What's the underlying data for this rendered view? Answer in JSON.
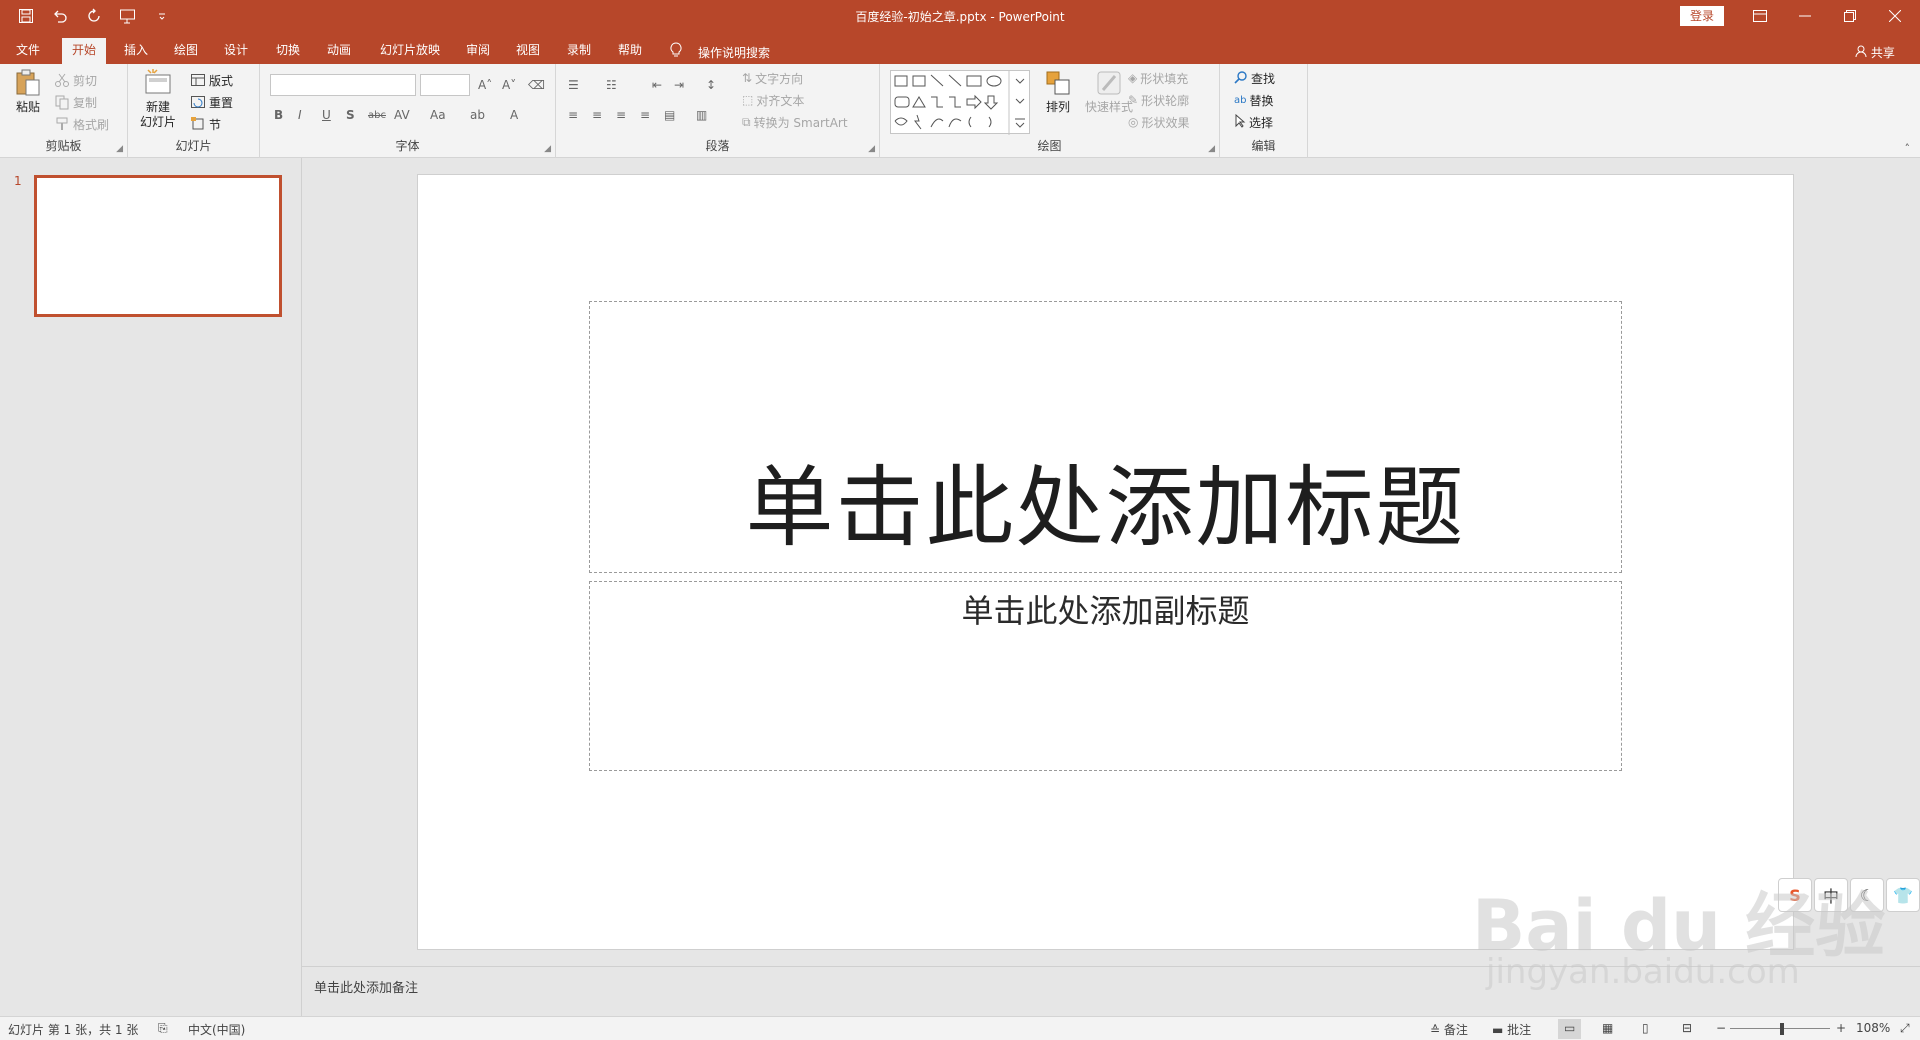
{
  "titlebar": {
    "document_title": "百度经验-初始之章.pptx  -  PowerPoint",
    "login": "登录",
    "qat_icons": [
      "save-icon",
      "undo-icon",
      "redo-icon",
      "presenter-icon",
      "customize-icon"
    ]
  },
  "tabs": [
    "文件",
    "开始",
    "插入",
    "绘图",
    "设计",
    "切换",
    "动画",
    "幻灯片放映",
    "审阅",
    "视图",
    "录制",
    "帮助"
  ],
  "active_tab": "开始",
  "tell_me": "操作说明搜索",
  "share": "共享",
  "ribbon": {
    "clipboard": {
      "label": "剪贴板",
      "paste": "粘贴",
      "cut": "剪切",
      "copy": "复制",
      "format_painter": "格式刷"
    },
    "slides": {
      "label": "幻灯片",
      "new_slide_line1": "新建",
      "new_slide_line2": "幻灯片",
      "layout": "版式",
      "reset": "重置",
      "section": "节"
    },
    "font": {
      "label": "字体",
      "bold": "B",
      "italic": "I",
      "underline": "U",
      "shadow": "S",
      "strike": "abc",
      "spacing": "AV",
      "case": "Aa",
      "color": "A"
    },
    "paragraph": {
      "label": "段落",
      "text_direction": "文字方向",
      "align_text": "对齐文本",
      "smartart": "转换为 SmartArt"
    },
    "drawing": {
      "label": "绘图",
      "arrange": "排列",
      "quick_styles": "快速样式",
      "shape_fill": "形状填充",
      "shape_outline": "形状轮廓",
      "shape_effects": "形状效果"
    },
    "editing": {
      "label": "编辑",
      "find": "查找",
      "replace": "替换",
      "select": "选择"
    }
  },
  "slide_pane": {
    "slide_number": "1"
  },
  "slide": {
    "title_placeholder": "单击此处添加标题",
    "subtitle_placeholder": "单击此处添加副标题"
  },
  "notes_placeholder": "单击此处添加备注",
  "statusbar": {
    "slide_info": "幻灯片 第 1 张，共 1 张",
    "language": "中文(中国)",
    "notes": "备注",
    "comments": "批注",
    "zoom": "108%"
  },
  "ime": [
    "中"
  ],
  "watermark": {
    "logo": "Bai du 经验",
    "url": "jingyan.baidu.com"
  },
  "colors": {
    "accent": "#b7472a",
    "ribbon_bg": "#f3f3f3",
    "workspace_bg": "#e6e6e6"
  }
}
